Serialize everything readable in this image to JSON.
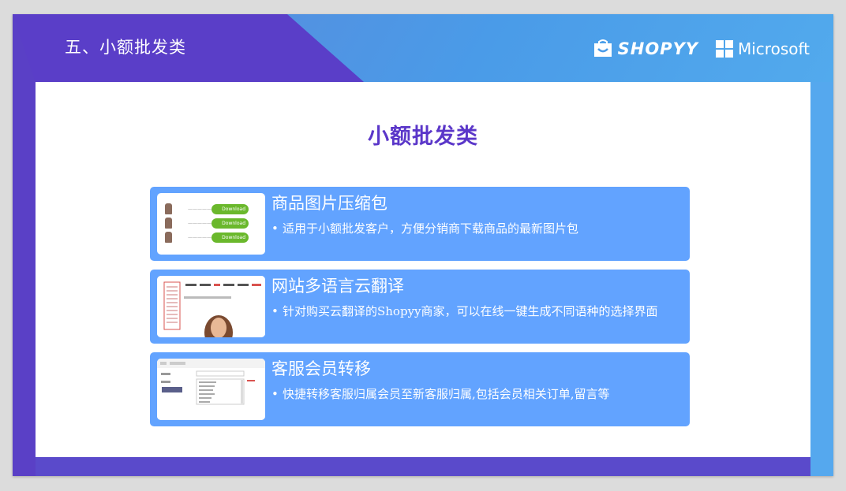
{
  "slide": {
    "title": "五、小额批发类",
    "brand_shopyy": "SHOPYY",
    "brand_microsoft": "Microsoft",
    "colors": {
      "purple": "#5a3ec8",
      "blue": "#4a9be8",
      "card": "#62a3ff",
      "heading": "#5b37c9"
    }
  },
  "content": {
    "heading": "小额批发类",
    "cards": [
      {
        "title": "商品图片压缩包",
        "bullet": "•",
        "description": "适用于小额批发客户，方便分销商下载商品的最新图片包",
        "thumb": {
          "rows": [
            "Download",
            "Download",
            "Download"
          ]
        }
      },
      {
        "title": "网站多语言云翻译",
        "bullet": "•",
        "description": "针对购买云翻译的Shopyy商家，可以在线一键生成不同语种的选择界面"
      },
      {
        "title": "客服会员转移",
        "bullet": "•",
        "description": "快捷转移客服归属会员至新客服归属,包括会员相关订单,留言等"
      }
    ]
  }
}
